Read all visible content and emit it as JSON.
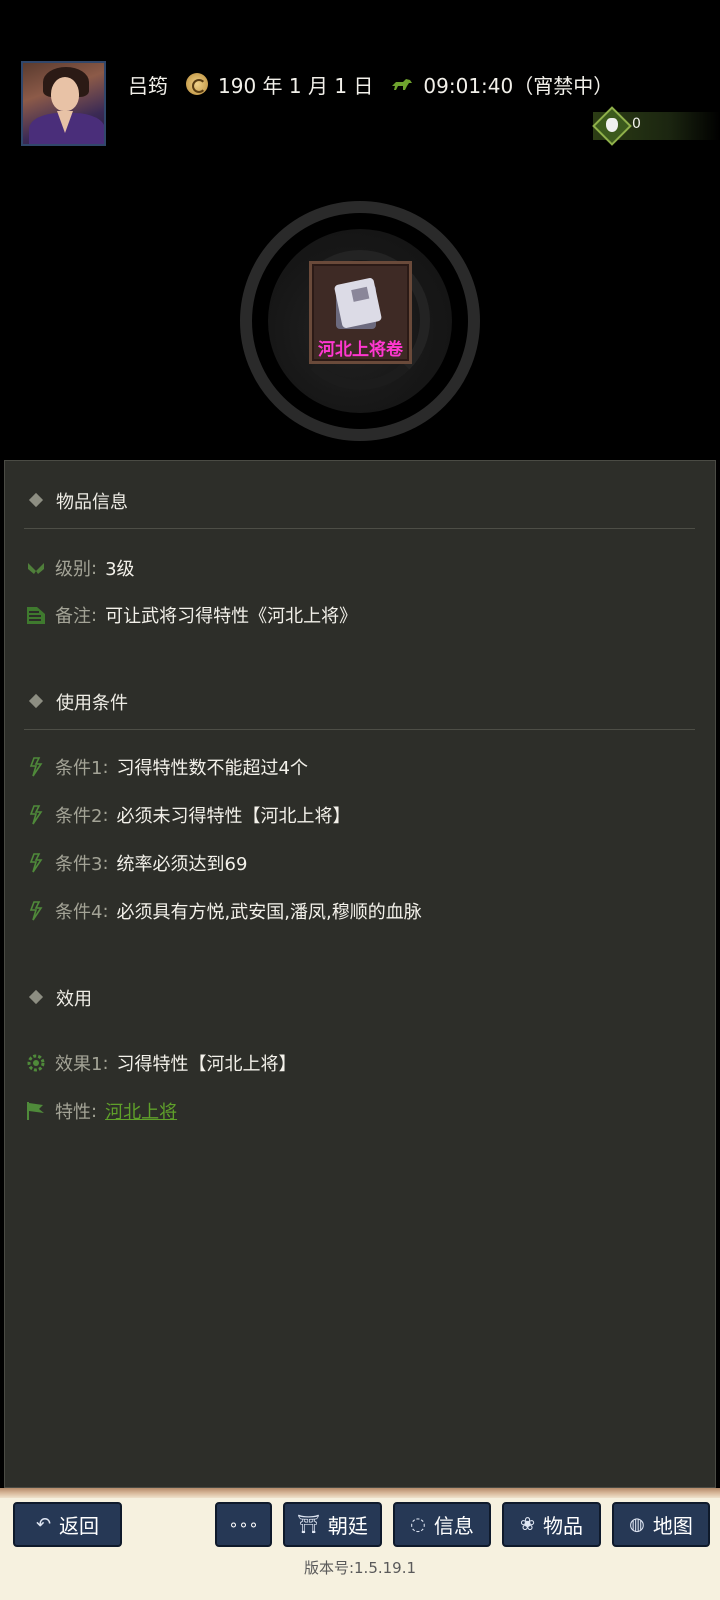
{
  "header": {
    "character_name": "吕筠",
    "date": "190 年 1 月 1 日",
    "time_status": "09:01:40（宵禁中）",
    "coins": "0"
  },
  "item": {
    "name": "河北上将卷"
  },
  "info_section": {
    "title": "物品信息",
    "rows": [
      {
        "key": "级别",
        "value": "3级",
        "icon": "wings-icon"
      },
      {
        "key": "备注",
        "value": "可让武将习得特性《河北上将》",
        "icon": "scroll-icon"
      }
    ]
  },
  "conditions_section": {
    "title": "使用条件",
    "rows": [
      {
        "key": "条件1",
        "value": "习得特性数不能超过4个",
        "icon": "lightning-icon"
      },
      {
        "key": "条件2",
        "value": "必须未习得特性【河北上将】",
        "icon": "lightning-icon"
      },
      {
        "key": "条件3",
        "value": "统率必须达到69",
        "icon": "lightning-icon"
      },
      {
        "key": "条件4",
        "value": "必须具有方悦,武安国,潘凤,穆顺的血脉",
        "icon": "lightning-icon"
      }
    ]
  },
  "effects_section": {
    "title": "效用",
    "rows": [
      {
        "key": "效果1",
        "value": "习得特性【河北上将】",
        "icon": "gear-icon"
      },
      {
        "key": "特性",
        "value": "河北上将",
        "icon": "flag-icon"
      }
    ]
  },
  "footer": {
    "back_label": "返回",
    "more_label": "∘∘∘",
    "court_label": "朝廷",
    "info_label": "信息",
    "items_label": "物品",
    "map_label": "地图",
    "version": "版本号:1.5.19.1"
  },
  "colors": {
    "item_name": "#ff37d0",
    "link": "#5fa02a",
    "panel_bg": "#2d2e29",
    "button_bg": "#263855"
  }
}
